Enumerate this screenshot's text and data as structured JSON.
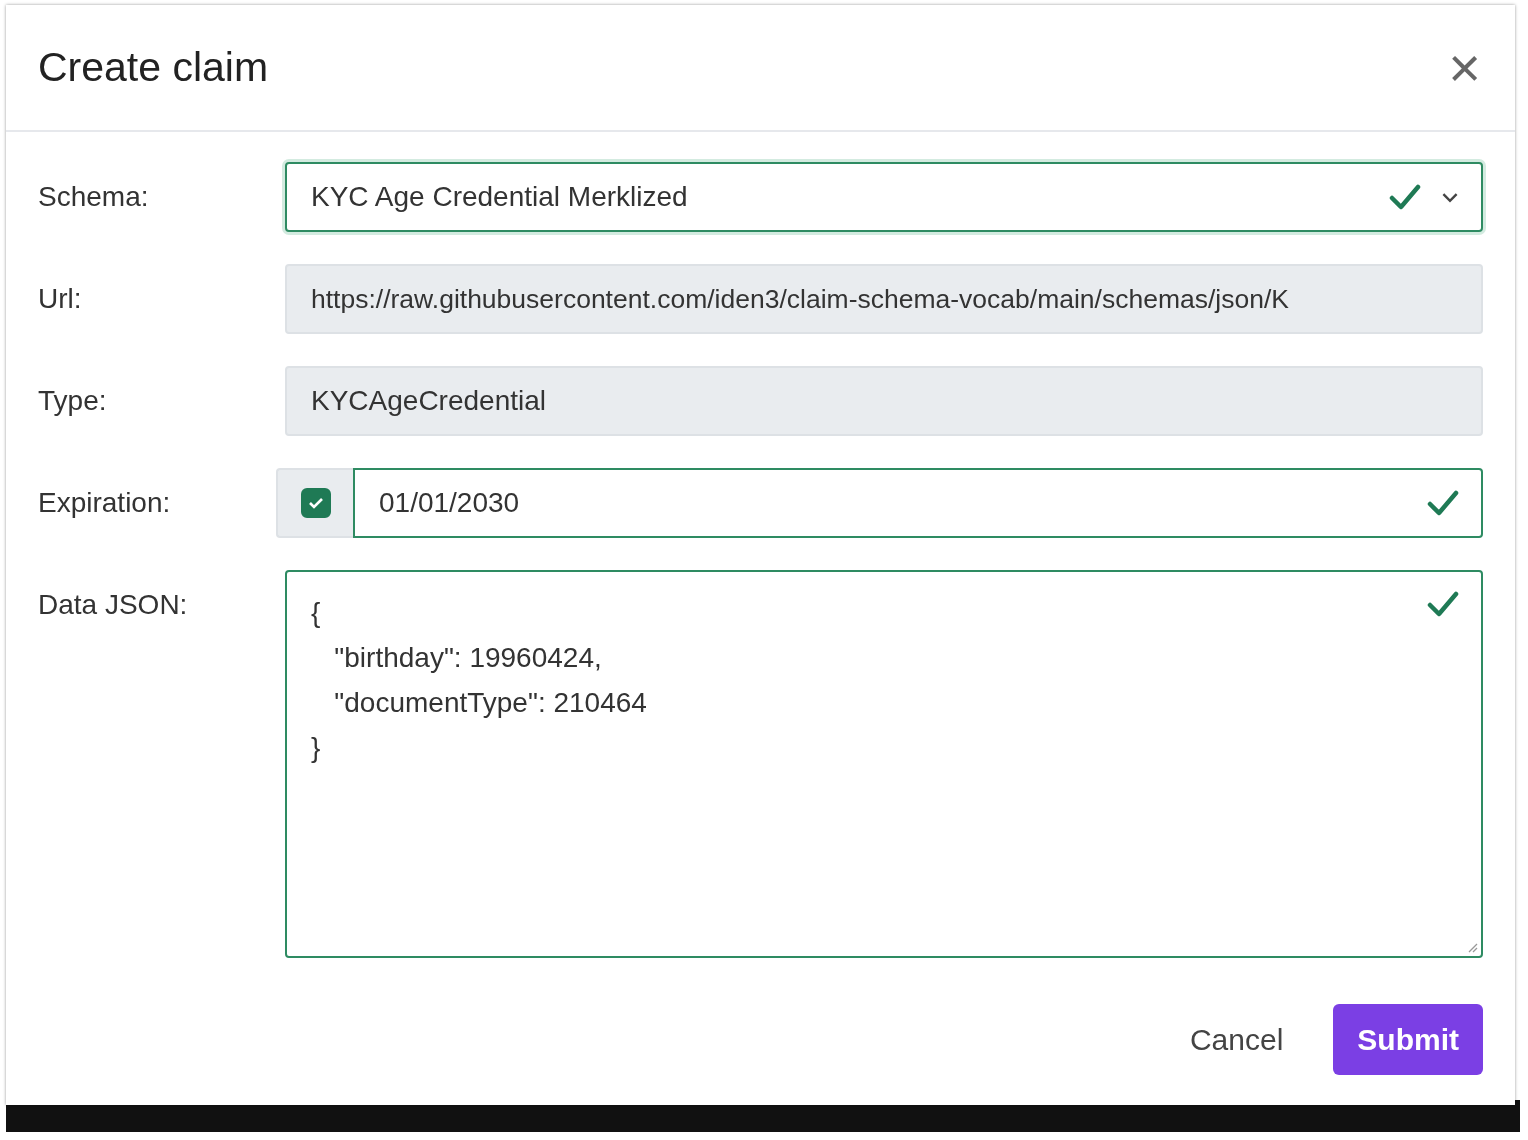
{
  "dialog": {
    "title": "Create claim",
    "close": "×"
  },
  "fields": [
    {
      "label": "Schema:",
      "kind": "select",
      "value": "KYC Age Credential Merklized",
      "disabled": false,
      "valid": true
    },
    {
      "label": "Url:",
      "kind": "text",
      "value": "https://raw.githubusercontent.com/iden3/claim-schema-vocab/main/schemas/json/K",
      "disabled": true,
      "valid": false
    },
    {
      "label": "Type:",
      "kind": "text",
      "value": "KYCAgeCredential",
      "disabled": true,
      "valid": false
    },
    {
      "label": "Expiration:",
      "kind": "date",
      "value": "01/01/2030",
      "disabled": false,
      "valid": true,
      "checked": true
    },
    {
      "label": "Data JSON:",
      "kind": "textarea",
      "value": "{\n   \"birthday\": 19960424,\n   \"documentType\": 210464\n}",
      "disabled": false,
      "valid": true
    }
  ],
  "buttons": [
    {
      "label": "Cancel",
      "kind": "link"
    },
    {
      "label": "Submit",
      "kind": "primary"
    }
  ]
}
